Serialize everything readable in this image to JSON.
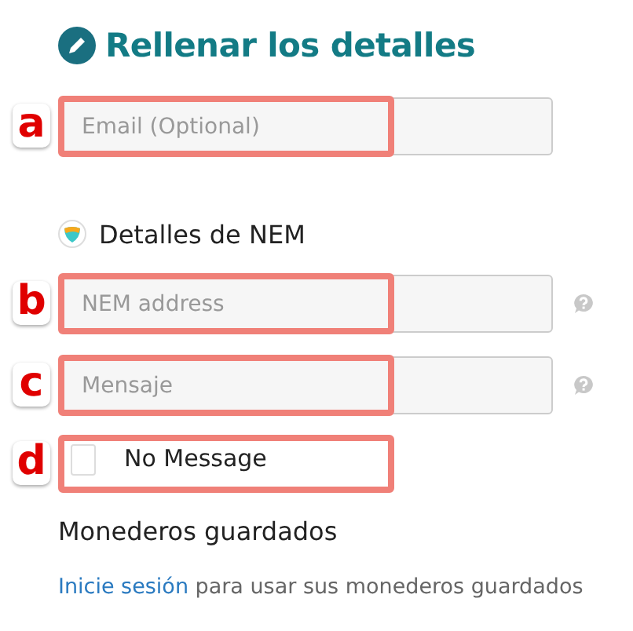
{
  "heading": {
    "title": "Rellenar los detalles"
  },
  "contact_fields": [
    {
      "callout": "a",
      "placeholder": "Email (Optional)",
      "help": false
    }
  ],
  "nem_section": {
    "title": "Detalles de NEM"
  },
  "nem_fields": [
    {
      "callout": "b",
      "placeholder": "NEM address",
      "help": true
    },
    {
      "callout": "c",
      "placeholder": "Mensaje",
      "help": true
    }
  ],
  "no_message": {
    "callout": "d",
    "label": "No Message",
    "checked": false
  },
  "saved_wallets": {
    "title": "Monederos guardados",
    "link": "Inicie sesión",
    "text": "para usar sus monederos guardados"
  }
}
